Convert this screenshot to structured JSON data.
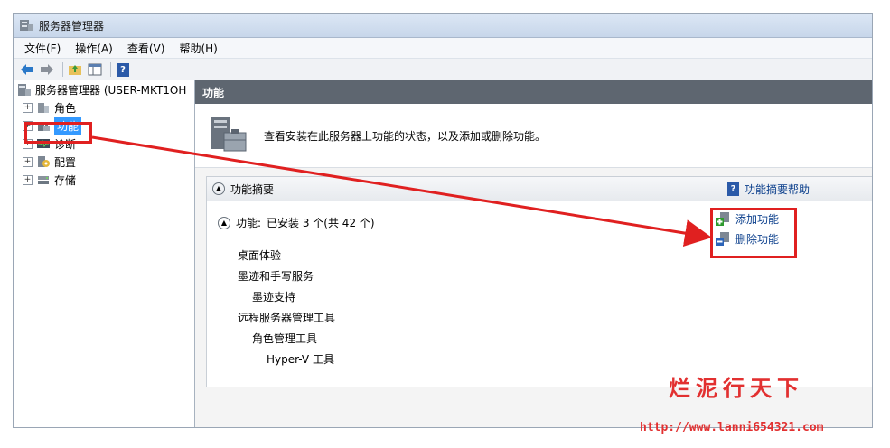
{
  "window": {
    "title": "服务器管理器"
  },
  "menu": [
    "文件(F)",
    "操作(A)",
    "查看(V)",
    "帮助(H)"
  ],
  "toolbar": {
    "help_glyph": "?"
  },
  "tree": {
    "root": "服务器管理器 (USER-MKT1OH",
    "items": [
      {
        "label": "角色",
        "icon": "roles-icon"
      },
      {
        "label": "功能",
        "icon": "features-icon"
      },
      {
        "label": "诊断",
        "icon": "diagnostics-icon"
      },
      {
        "label": "配置",
        "icon": "configuration-icon"
      },
      {
        "label": "存储",
        "icon": "storage-icon"
      }
    ],
    "expander": "+"
  },
  "content": {
    "header": "功能",
    "description": "查看安装在此服务器上功能的状态，以及添加或删除功能。",
    "summary": {
      "title": "功能摘要",
      "help_link": "功能摘要帮助",
      "installed_label": "功能:",
      "installed_text": "已安装 3 个(共 42 个)",
      "items": [
        {
          "label": "桌面体验",
          "indent": 0
        },
        {
          "label": "墨迹和手写服务",
          "indent": 0
        },
        {
          "label": "墨迹支持",
          "indent": 1
        },
        {
          "label": "远程服务器管理工具",
          "indent": 0
        },
        {
          "label": "角色管理工具",
          "indent": 1
        },
        {
          "label": "Hyper-V 工具",
          "indent": 2
        }
      ],
      "actions": {
        "add": "添加功能",
        "remove": "删除功能"
      }
    }
  },
  "watermark": {
    "title": "烂泥行天下",
    "url": "http://www.lanni654321.com"
  },
  "colors": {
    "annotation": "#e02020",
    "link": "#0b3f8c",
    "selected": "#3399ff"
  }
}
